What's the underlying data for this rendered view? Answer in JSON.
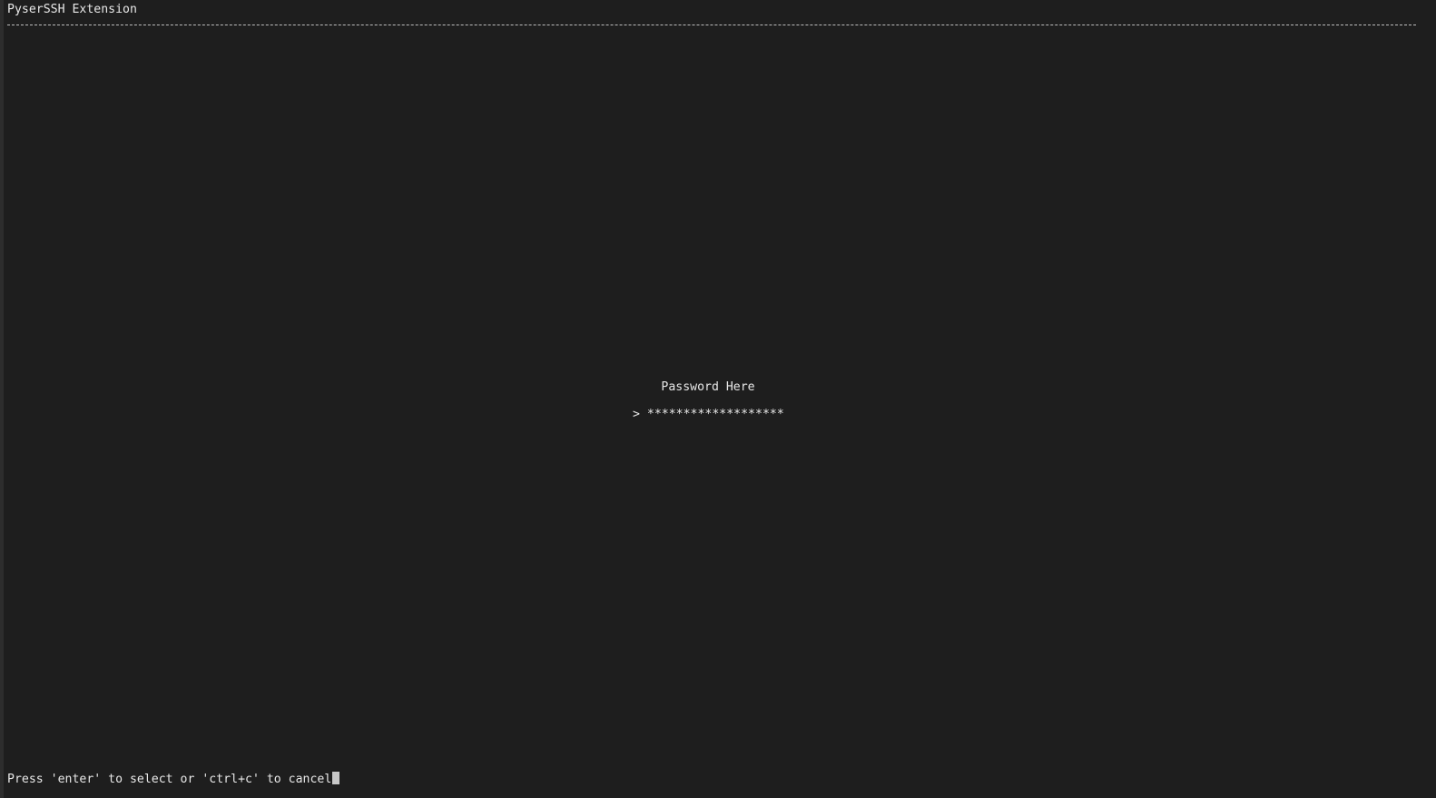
{
  "window": {
    "title": "PyserSSH Extension"
  },
  "prompt": {
    "label": "Password Here",
    "marker": ">",
    "masked_value": "*******************"
  },
  "footer": {
    "hint": "Press 'enter' to select or 'ctrl+c' to cancel"
  },
  "colors": {
    "background": "#1e1e1e",
    "text": "#e8e8e8"
  }
}
